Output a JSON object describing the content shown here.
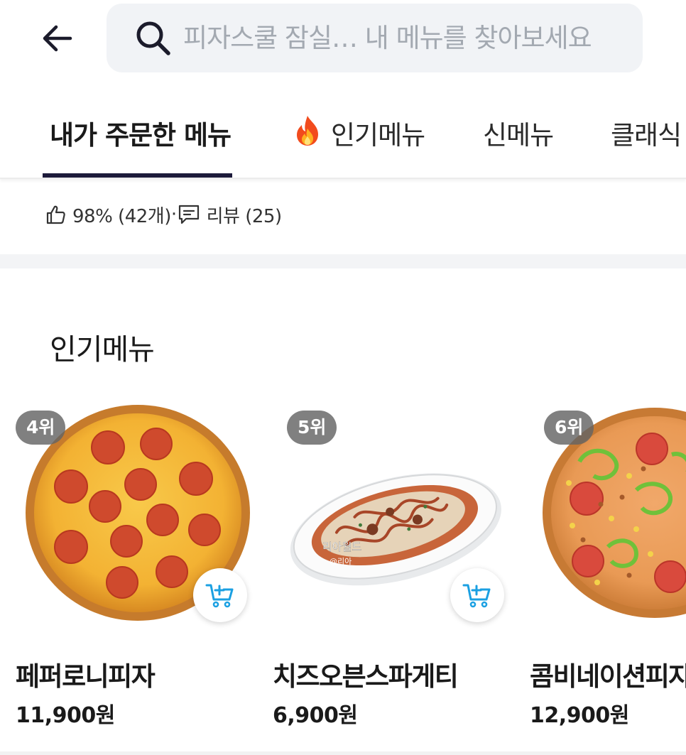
{
  "search": {
    "placeholder": "피자스쿨 잠실… 내 메뉴를 찾아보세요",
    "value": ""
  },
  "tabs": [
    {
      "label": "내가 주문한 메뉴",
      "active": true
    },
    {
      "label": "인기메뉴",
      "icon": "fire-icon"
    },
    {
      "label": "신메뉴"
    },
    {
      "label": "클래식"
    }
  ],
  "stats": {
    "like_text": "98% (42개)",
    "separator": "·",
    "review_text": "리뷰 (25)"
  },
  "section": {
    "title": "인기메뉴"
  },
  "products": [
    {
      "rank": "4위",
      "name": "페퍼로니피자",
      "price": "11,900원",
      "image": "pepperoni-pizza"
    },
    {
      "rank": "5위",
      "name": "치즈오븐스파게티",
      "price": "6,900원",
      "image": "cheese-oven-spaghetti",
      "watermark": "리아월드",
      "watermark_sub": "@리아"
    },
    {
      "rank": "6위",
      "name": "콤비네이션피자",
      "price": "12,900원",
      "image": "combination-pizza"
    }
  ],
  "colors": {
    "accent": "#1c1a3a",
    "cart": "#1ba0e2",
    "search_bg": "#f1f3f6",
    "rank_bg": "#646464"
  }
}
